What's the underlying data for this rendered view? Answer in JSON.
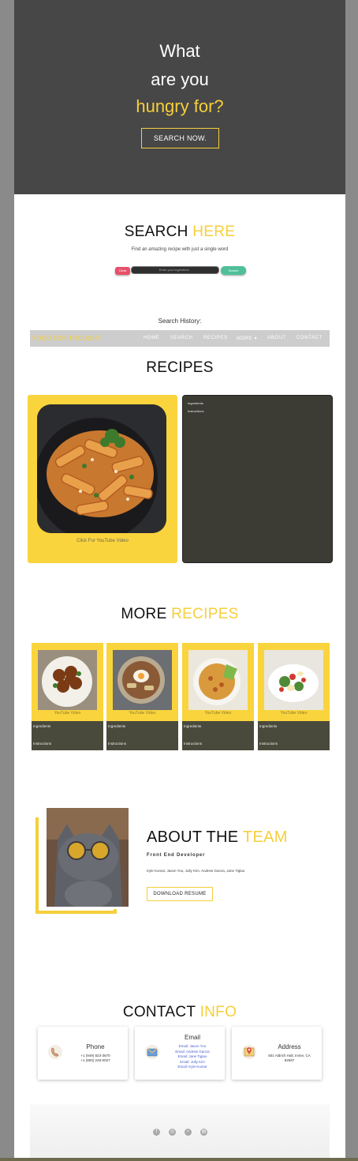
{
  "hero": {
    "line1": "What",
    "line2": "are you",
    "line3": "hungry for?",
    "button": "SEARCH NOW."
  },
  "search": {
    "title_a": "SEARCH ",
    "title_b": "HERE",
    "subtitle": "Find an amazing recipe with just a single word",
    "clear_label": "Clear",
    "placeholder": "Enter your ingredient...",
    "search_label": "Search",
    "history_label": "Search History:"
  },
  "nav": {
    "brand": "FOOD FOR THOUGHT",
    "items": [
      "HOME",
      "SEARCH",
      "RECIPES",
      "MORE ▾",
      "ABOUT",
      "CONTACT"
    ]
  },
  "recipes": {
    "title": "RECIPES",
    "caption": "Click For YouTube Video",
    "ingredients_label": "Ingredients",
    "instructions_label": "Instructions"
  },
  "more": {
    "title_a": "MORE ",
    "title_b": "RECIPES",
    "cards": [
      {
        "caption": "YouTube Video",
        "ingredients": "Ingredients",
        "instructions": "Instructions"
      },
      {
        "caption": "YouTube Video",
        "ingredients": "Ingredients",
        "instructions": "Instructions"
      },
      {
        "caption": "YouTube Video",
        "ingredients": "Ingredients",
        "instructions": "Instructions"
      },
      {
        "caption": "YouTube Video",
        "ingredients": "Ingredients",
        "instructions": "Instructions"
      }
    ]
  },
  "about": {
    "title_a": "ABOUT THE ",
    "title_b": "TEAM",
    "role": "Front End Developer",
    "names": "Kyle Kumar, Jason Yoo, Jully Kim, Andrew Garcia, Jane Tiglao",
    "button": "DOWNLOAD RESUME"
  },
  "contact": {
    "title_a": "CONTACT ",
    "title_b": "INFO",
    "phone": {
      "title": "Phone",
      "lines": [
        "+1 (949) 823-3670",
        "+1 (800) 248-0027"
      ]
    },
    "email": {
      "title": "Email",
      "lines": [
        "Email: Jason Yoo",
        "Email: Andrew Garcia",
        "Email: Jane Tiglao",
        "Email: Jully Kim",
        "Email: Kyle Kumar"
      ]
    },
    "address": {
      "title": "Address",
      "lines": [
        "501 Aldrich Hall, Irvine, CA",
        "92697"
      ]
    }
  },
  "footer": {
    "icons": [
      "facebook-icon",
      "instagram-icon",
      "twitter-icon",
      "linkedin-icon"
    ]
  },
  "colors": {
    "accent": "#f6cf3a",
    "hero_bg": "#474747",
    "card_dark": "#3c3c34",
    "clear_btn": "#e8506a",
    "search_btn": "#4fbf9a"
  }
}
